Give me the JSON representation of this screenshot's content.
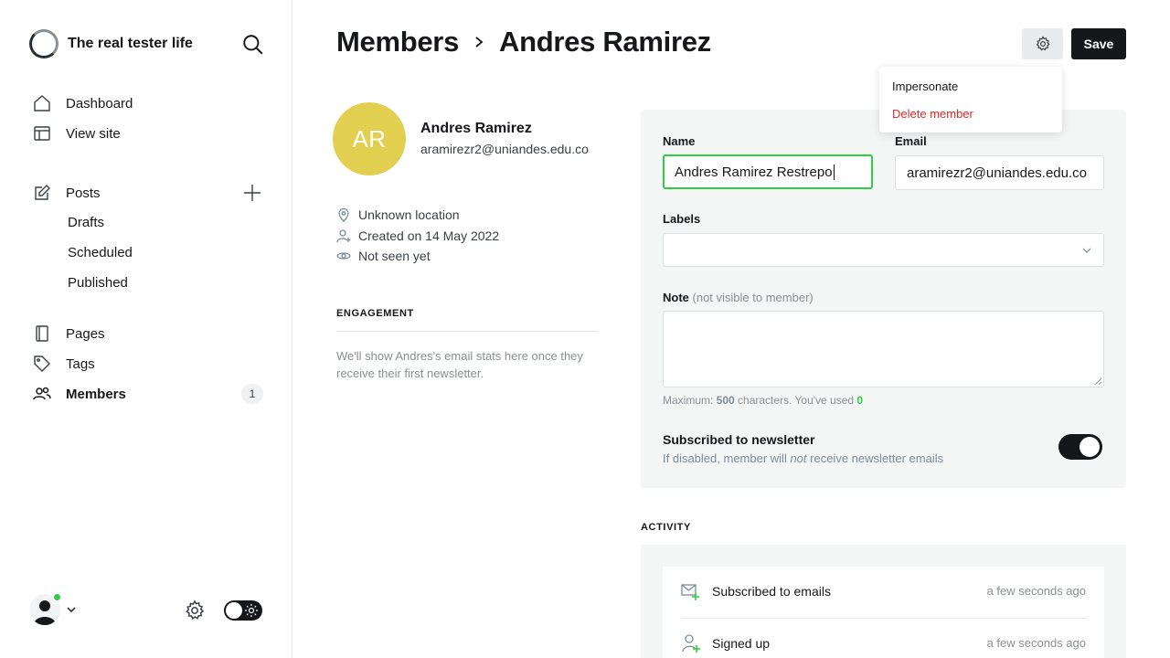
{
  "brand": {
    "title": "The real tester life"
  },
  "nav": {
    "dashboard": "Dashboard",
    "view_site": "View site",
    "posts": "Posts",
    "drafts": "Drafts",
    "scheduled": "Scheduled",
    "published": "Published",
    "pages": "Pages",
    "tags": "Tags",
    "members": "Members",
    "members_count": "1"
  },
  "header": {
    "breadcrumb_parent": "Members",
    "breadcrumb_current": "Andres Ramirez",
    "save_label": "Save"
  },
  "dropdown": {
    "impersonate": "Impersonate",
    "delete_member": "Delete member"
  },
  "profile": {
    "initials": "AR",
    "name": "Andres Ramirez",
    "email": "aramirezr2@uniandes.edu.co",
    "location": "Unknown location",
    "created": "Created on 14 May 2022",
    "last_seen": "Not seen yet"
  },
  "engagement": {
    "heading": "ENGAGEMENT",
    "text": "We'll show Andres's email stats here once they receive their first newsletter."
  },
  "form": {
    "name_label": "Name",
    "name_value": "Andres Ramirez Restrepo",
    "email_label": "Email",
    "email_value": "aramirezr2@uniandes.edu.co",
    "labels_label": "Labels",
    "note_label": "Note",
    "note_muted": "(not visible to member)",
    "hint_prefix": "Maximum: ",
    "hint_max": "500",
    "hint_mid": " characters. You've used ",
    "hint_used": "0",
    "subscribed_title": "Subscribed to newsletter",
    "subscribed_desc_1": "If disabled, member will ",
    "subscribed_desc_em": "not",
    "subscribed_desc_2": " receive newsletter emails",
    "subscribed": true
  },
  "activity": {
    "heading": "ACTIVITY",
    "items": [
      {
        "label": "Subscribed to emails",
        "time": "a few seconds ago",
        "icon": "mail-plus-icon"
      },
      {
        "label": "Signed up",
        "time": "a few seconds ago",
        "icon": "user-plus-icon"
      }
    ]
  },
  "colors": {
    "accent_green": "#30cf43",
    "danger_red": "#f50b23",
    "avatar_yellow": "#e2cf4f",
    "dark": "#15171a"
  }
}
